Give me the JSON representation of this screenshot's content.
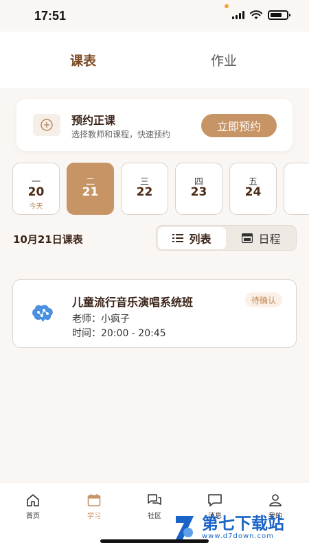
{
  "status_bar": {
    "time": "17:51"
  },
  "top_tabs": [
    {
      "label": "课表",
      "active": true
    },
    {
      "label": "作业",
      "active": false
    }
  ],
  "booking": {
    "title": "预约正课",
    "subtitle": "选择教师和课程，快速预约",
    "button": "立即预约",
    "icon": "plus-circle-icon"
  },
  "days": [
    {
      "weekday": "一",
      "date": "20",
      "note": "今天",
      "selected": false
    },
    {
      "weekday": "二",
      "date": "21",
      "note": "",
      "selected": true
    },
    {
      "weekday": "三",
      "date": "22",
      "note": "",
      "selected": false
    },
    {
      "weekday": "四",
      "date": "23",
      "note": "",
      "selected": false
    },
    {
      "weekday": "五",
      "date": "24",
      "note": "",
      "selected": false
    }
  ],
  "schedule": {
    "title": "10月21日课表",
    "view_list": "列表",
    "view_calendar": "日程"
  },
  "courses": [
    {
      "title": "儿童流行音乐演唱系统班",
      "status": "待确认",
      "teacher": "老师：小疯子",
      "time": "时间：20:00 - 20:45",
      "icon": "brain-icon"
    }
  ],
  "bottom_nav": [
    {
      "label": "首页",
      "icon": "home-icon",
      "active": false
    },
    {
      "label": "学习",
      "icon": "calendar-icon",
      "active": true
    },
    {
      "label": "社区",
      "icon": "chat-bubbles-icon",
      "active": false
    },
    {
      "label": "消息",
      "icon": "message-icon",
      "active": false
    },
    {
      "label": "我的",
      "icon": "user-icon",
      "active": false
    }
  ],
  "watermark": {
    "title": "第七下载站",
    "url": "www.d7down.com"
  },
  "colors": {
    "accent": "#c79466",
    "accent_dark": "#7a4a22",
    "background": "#faf6f3"
  }
}
